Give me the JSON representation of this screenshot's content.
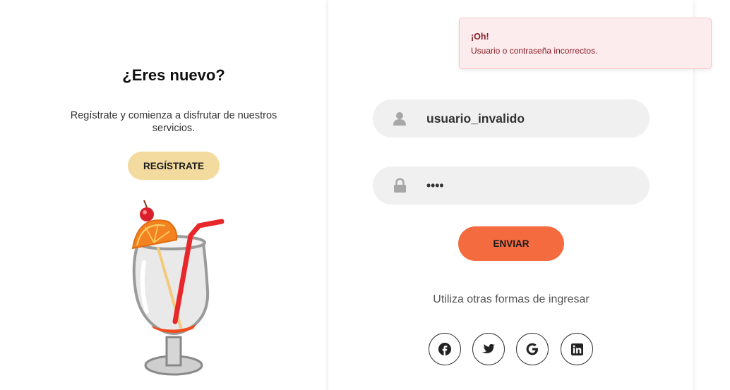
{
  "left": {
    "title": "¿Eres nuevo?",
    "description": "Regístrate y comienza a disfrutar de nuestros servicios.",
    "register_label": "REGÍSTRATE"
  },
  "login": {
    "username_value": "usuario_invalido",
    "password_value": "••••",
    "send_label": "ENVIAR",
    "alt_login_text": "Utiliza otras formas de ingresar",
    "social": [
      "facebook-icon",
      "twitter-icon",
      "google-icon",
      "linkedin-icon"
    ]
  },
  "toast": {
    "title": "¡Oh!",
    "message": "Usuario o contraseña incorrectos."
  },
  "colors": {
    "register_button": "#f3da9e",
    "send_button": "#f36b3e",
    "input_background": "#f0f0f0",
    "toast_background": "#fdecee",
    "toast_text": "#8a1c24"
  }
}
